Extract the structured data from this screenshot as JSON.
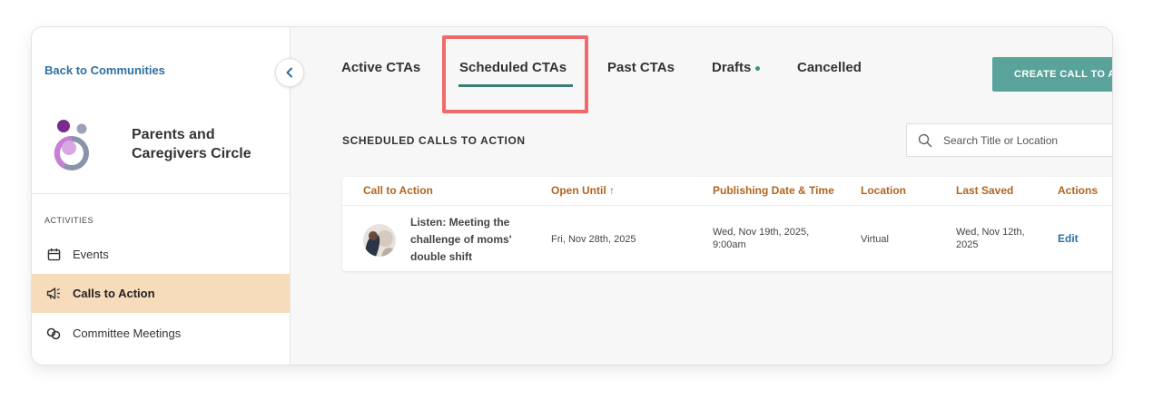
{
  "sidebar": {
    "back_label": "Back to Communities",
    "community_name": "Parents and Caregivers Circle",
    "section_label": "ACTIVITIES",
    "items": [
      {
        "label": "Events",
        "icon": "calendar-icon"
      },
      {
        "label": "Calls to Action",
        "icon": "megaphone-icon",
        "active": true
      },
      {
        "label": "Committee Meetings",
        "icon": "meeting-icon"
      }
    ]
  },
  "tabs": [
    {
      "label": "Active CTAs"
    },
    {
      "label": "Scheduled CTAs",
      "active": true
    },
    {
      "label": "Past CTAs"
    },
    {
      "label": "Drafts",
      "has_dot": true
    },
    {
      "label": "Cancelled"
    }
  ],
  "create_button_label": "CREATE CALL TO A",
  "list_heading": "SCHEDULED CALLS TO ACTION",
  "search": {
    "placeholder": "Search Title or Location",
    "value": ""
  },
  "table": {
    "columns": [
      "Call to Action",
      "Open Until ↑",
      "Publishing Date & Time",
      "Location",
      "Last Saved",
      "Actions"
    ],
    "rows": [
      {
        "title": "Listen: Meeting the challenge of moms' double shift",
        "open_until": "Fri, Nov 28th, 2025",
        "publishing": "Wed, Nov 19th, 2025, 9:00am",
        "location": "Virtual",
        "last_saved": "Wed, Nov 12th, 2025",
        "action": "Edit"
      }
    ]
  },
  "colors": {
    "accent_teal": "#5aa39a",
    "tab_underline": "#3a7d74",
    "header_orange": "#b0651f",
    "link_blue": "#2f6fa0",
    "active_nav_bg": "#f7dcbb",
    "highlight_red": "#f06a6a"
  }
}
